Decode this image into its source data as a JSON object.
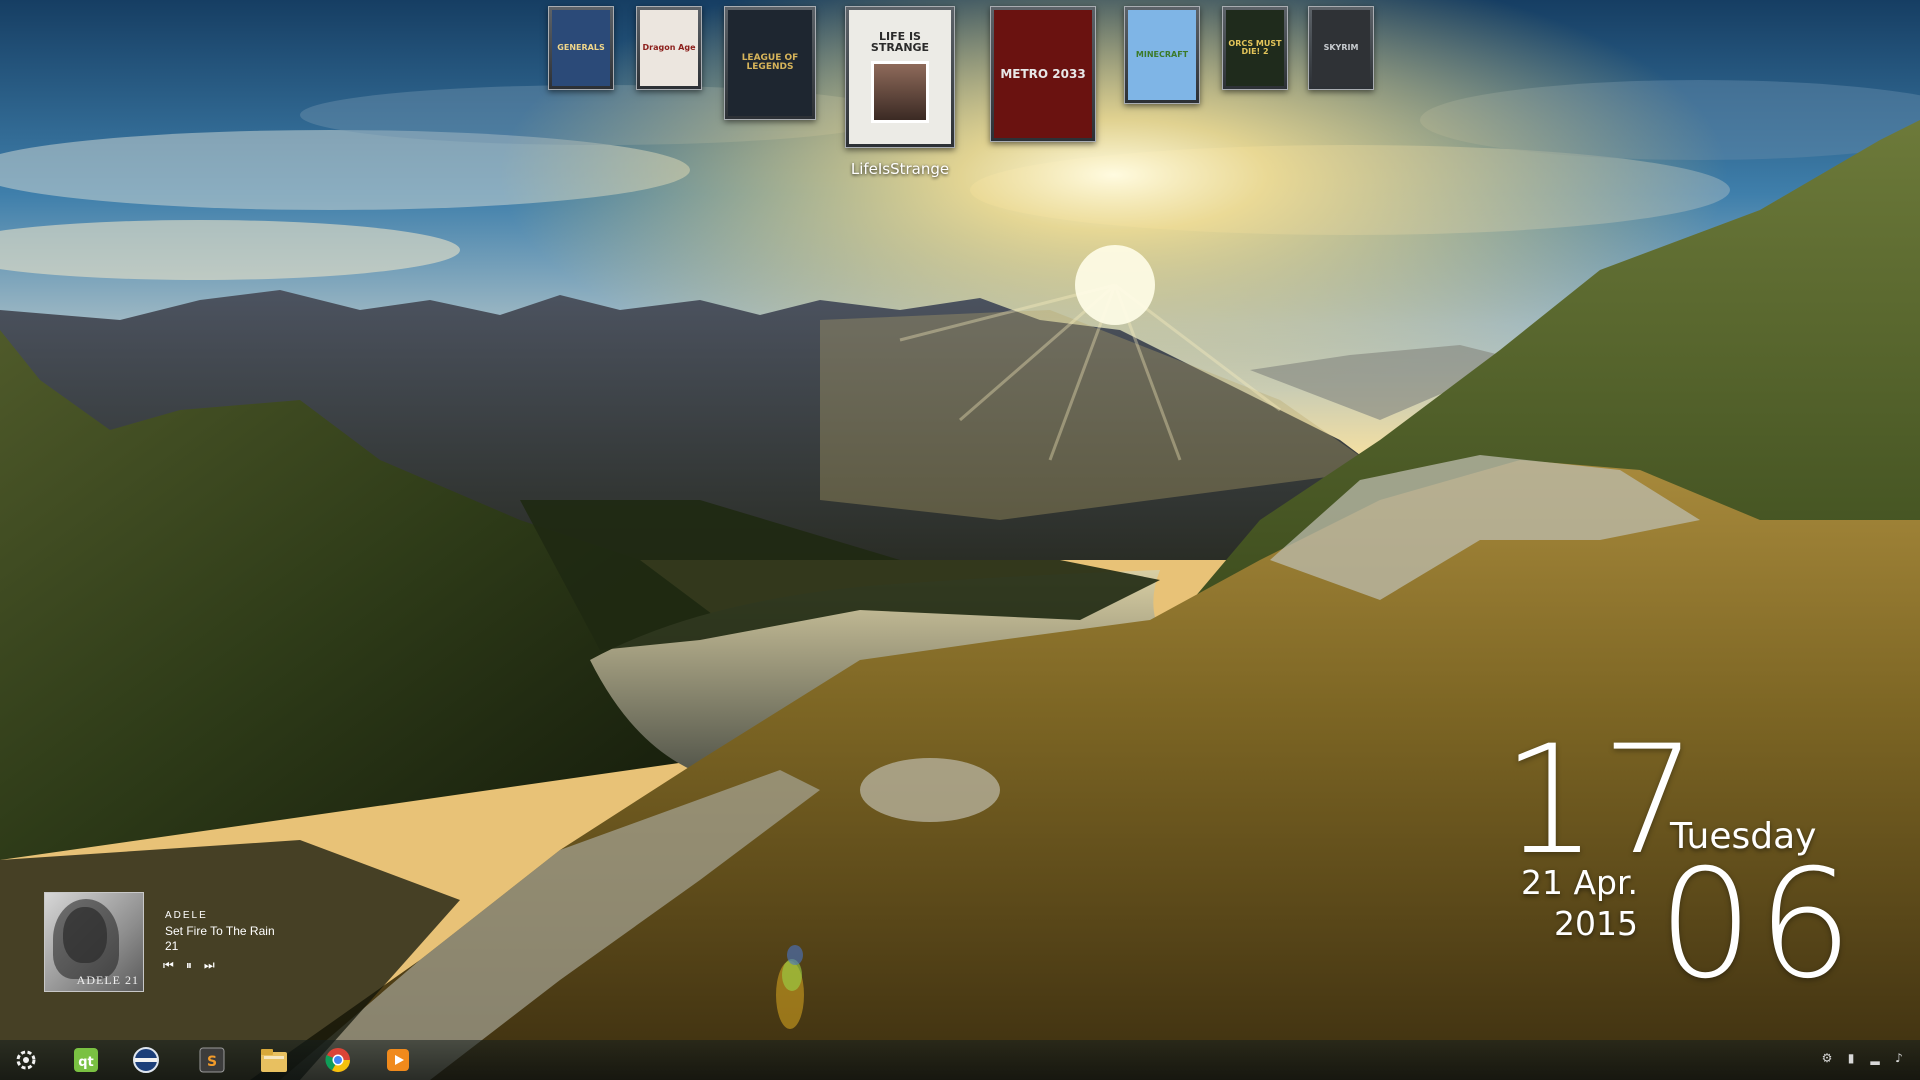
{
  "desktop": {
    "hovered_game_label": "LifeIsStrange",
    "games": [
      {
        "name": "generals",
        "cover_text": "GENERALS",
        "bg": "#2b4a78",
        "fg": "#f0d68a"
      },
      {
        "name": "dragon-age",
        "cover_text": "Dragon Age",
        "bg": "#ece6df",
        "fg": "#8c1f1b"
      },
      {
        "name": "league-of-legends",
        "cover_text": "LEAGUE OF LEGENDS",
        "bg": "#1e2630",
        "fg": "#d7b45a"
      },
      {
        "name": "life-is-strange",
        "cover_text": "LIFE IS STRANGE",
        "bg": "#ecebe6",
        "fg": "#2b2b2b"
      },
      {
        "name": "metro-2033",
        "cover_text": "METRO 2033",
        "bg": "#6a1210",
        "fg": "#e8e8e8"
      },
      {
        "name": "minecraft",
        "cover_text": "MINECRAFT",
        "bg": "#7fb5e6",
        "fg": "#3c7a2a"
      },
      {
        "name": "orcs-must-die-2",
        "cover_text": "ORCS MUST DIE! 2",
        "bg": "#1f2b1c",
        "fg": "#e2c45a"
      },
      {
        "name": "skyrim",
        "cover_text": "SKYRIM",
        "bg": "#2f3236",
        "fg": "#c9cdd1"
      }
    ]
  },
  "clock": {
    "hour": "17",
    "minute": "06",
    "weekday": "Tuesday",
    "date": "21 Apr.",
    "year": "2015"
  },
  "player": {
    "artist": "ADELE",
    "track": "Set Fire To The Rain",
    "album": "21",
    "art_caption": "ADELE 21",
    "controls": {
      "prev": "⏮",
      "pause": "⏸",
      "next": "⏭"
    }
  },
  "taskbar": {
    "icons": [
      "start-orb-icon",
      "qbittorrent-icon",
      "media-player-icon",
      "sublime-text-icon",
      "file-explorer-icon",
      "chrome-icon",
      "media-center-icon"
    ],
    "tray_icons": [
      "network-icon",
      "battery-icon",
      "signal-icon",
      "volume-icon"
    ]
  },
  "colors": {
    "sky_top": "#1f4d7a",
    "sun": "#fff3b0",
    "grass": "#b58a2a",
    "taskbar": "#101818"
  }
}
